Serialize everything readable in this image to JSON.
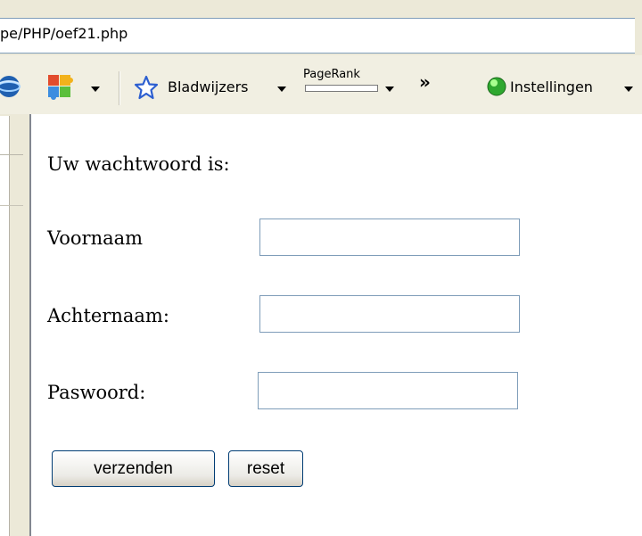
{
  "browser": {
    "address": "pe/PHP/oef21.php",
    "toolbar": {
      "bookmarks_label": "Bladwijzers",
      "pagerank_label": "PageRank",
      "more_label": "»",
      "settings_label": "Instellingen"
    }
  },
  "form": {
    "password_text": "Uw wachtwoord is:",
    "firstname_label": "Voornaam",
    "lastname_label": "Achternaam:",
    "password_label": "Paswoord:",
    "firstname_value": "",
    "lastname_value": "",
    "password_value": "",
    "submit_label": "verzenden",
    "reset_label": "reset"
  },
  "icons": {
    "globe": "globe-icon",
    "puzzle": "puzzle-icon",
    "star": "star-icon",
    "status": "green-status-icon"
  },
  "colors": {
    "field_border": "#7f9db9",
    "button_border": "#003c74",
    "chrome": "#ece9d8",
    "status_green": "#2fa82f"
  }
}
